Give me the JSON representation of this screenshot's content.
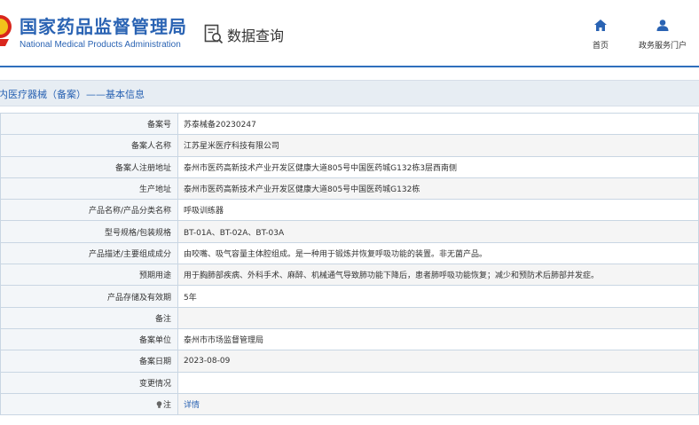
{
  "header": {
    "brand_cn": "国家药品监督管理局",
    "brand_en": "National Medical Products Administration",
    "search_label": "数据查询",
    "nav": [
      {
        "label": "首页",
        "icon": "home-icon"
      },
      {
        "label": "政务服务门户",
        "icon": "user-icon"
      }
    ]
  },
  "section": {
    "title": "内医疗器械（备案）——基本信息"
  },
  "table": {
    "rows": [
      {
        "label": "备案号",
        "value": "苏泰械备20230247"
      },
      {
        "label": "备案人名称",
        "value": "江苏星米医疗科技有限公司"
      },
      {
        "label": "备案人注册地址",
        "value": "泰州市医药高新技术产业开发区健康大道805号中国医药城G132栋3层西南侧"
      },
      {
        "label": "生产地址",
        "value": "泰州市医药高新技术产业开发区健康大道805号中国医药城G132栋"
      },
      {
        "label": "产品名称/产品分类名称",
        "value": "呼吸训练器"
      },
      {
        "label": "型号规格/包装规格",
        "value": "BT-01A、BT-02A、BT-03A"
      },
      {
        "label": "产品描述/主要组成成分",
        "value": "由咬嘴、吸气容量主体腔组成。是一种用于锻炼并恢复呼吸功能的装置。非无菌产品。"
      },
      {
        "label": "预期用途",
        "value": "用于胸肺部疾病、外科手术、麻醉、机械通气导致肺功能下降后，患者肺呼吸功能恢复；减少和预防术后肺部并发症。"
      },
      {
        "label": "产品存储及有效期",
        "value": "5年"
      },
      {
        "label": "备注",
        "value": ""
      },
      {
        "label": "备案单位",
        "value": "泰州市市场监督管理局"
      },
      {
        "label": "备案日期",
        "value": "2023-08-09"
      },
      {
        "label": "变更情况",
        "value": ""
      },
      {
        "label": "注",
        "value": "详情"
      }
    ]
  },
  "colors": {
    "brand_blue": "#2a63b3",
    "label_bg": "#f3f6f9",
    "border": "#c9d6e3"
  }
}
